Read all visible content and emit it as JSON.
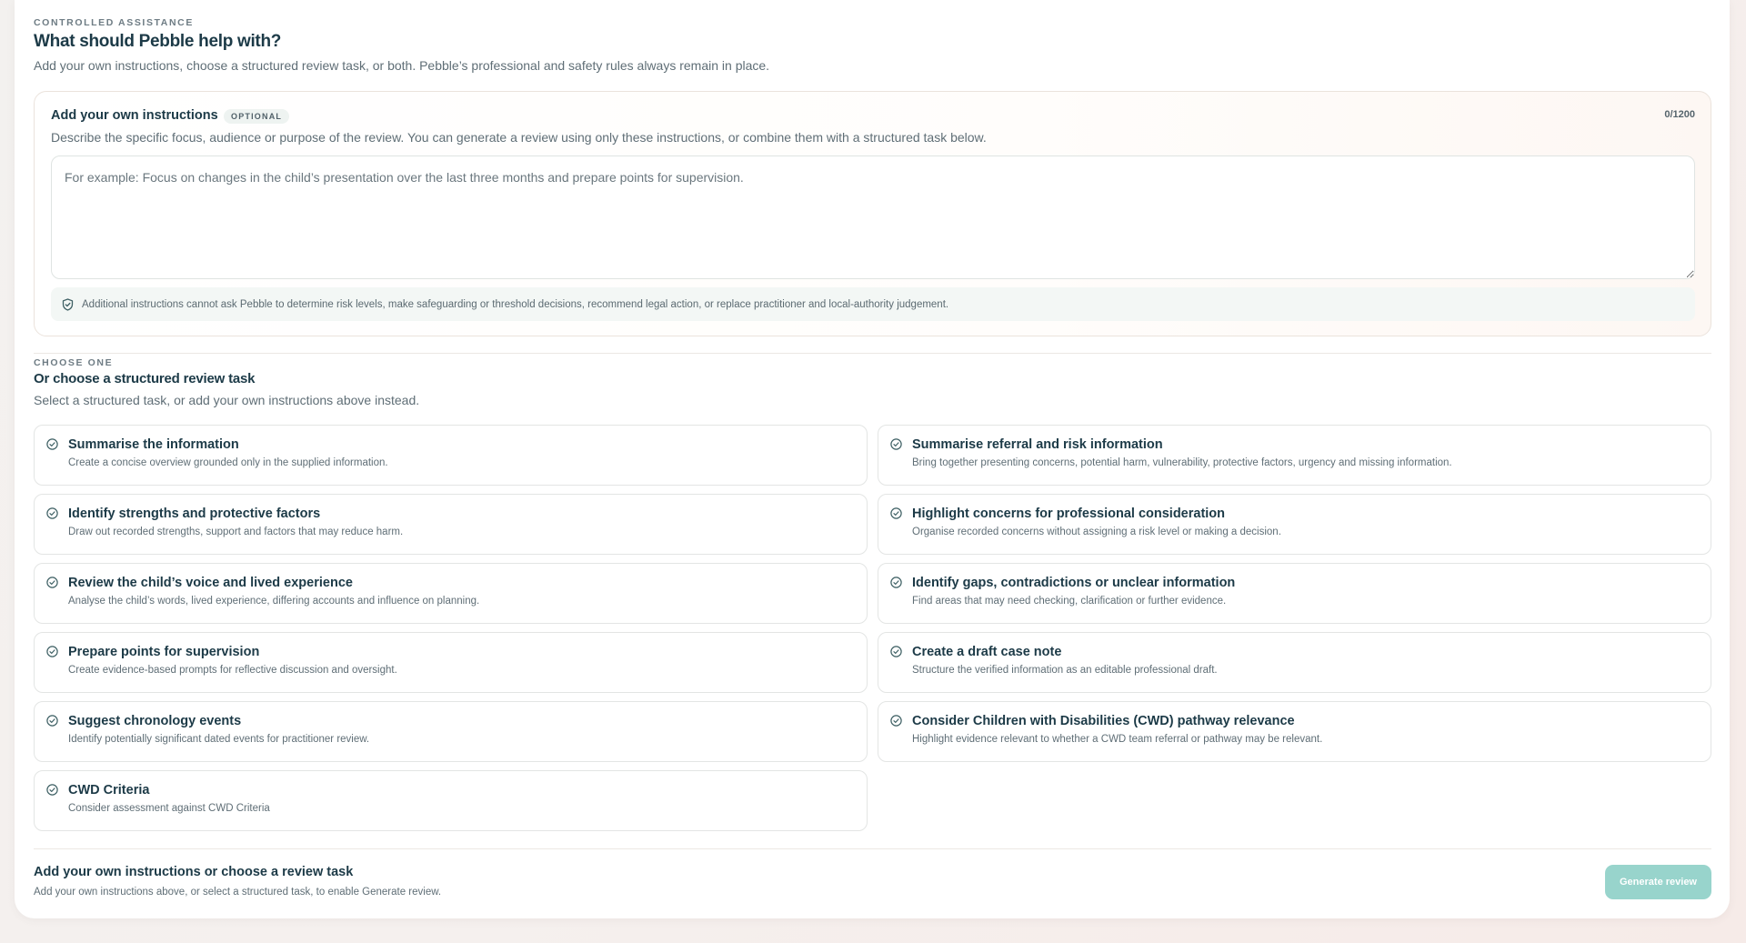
{
  "header": {
    "eyebrow": "CONTROLLED ASSISTANCE",
    "title": "What should Pebble help with?",
    "subtitle": "Add your own instructions, choose a structured review task, or both. Pebble’s professional and safety rules always remain in place."
  },
  "instructions": {
    "title": "Add your own instructions",
    "badge": "OPTIONAL",
    "char_count": "0/1200",
    "description": "Describe the specific focus, audience or purpose of the review. You can generate a review using only these instructions, or combine them with a structured task below.",
    "placeholder": "For example: Focus on changes in the child’s presentation over the last three months and prepare points for supervision.",
    "value": "",
    "notice_icon": "shield-check-icon",
    "notice": "Additional instructions cannot ask Pebble to determine risk levels, make safeguarding or threshold decisions, recommend legal action, or replace practitioner and local-authority judgement."
  },
  "tasks_section": {
    "eyebrow": "CHOOSE ONE",
    "title": "Or choose a structured review task",
    "subtitle": "Select a structured task, or add your own instructions above instead.",
    "item_icon": "check-circle-icon",
    "tasks": [
      {
        "title": "Summarise the information",
        "description": "Create a concise overview grounded only in the supplied information."
      },
      {
        "title": "Summarise referral and risk information",
        "description": "Bring together presenting concerns, potential harm, vulnerability, protective factors, urgency and missing information."
      },
      {
        "title": "Identify strengths and protective factors",
        "description": "Draw out recorded strengths, support and factors that may reduce harm."
      },
      {
        "title": "Highlight concerns for professional consideration",
        "description": "Organise recorded concerns without assigning a risk level or making a decision."
      },
      {
        "title": "Review the child’s voice and lived experience",
        "description": "Analyse the child’s words, lived experience, differing accounts and influence on planning."
      },
      {
        "title": "Identify gaps, contradictions or unclear information",
        "description": "Find areas that may need checking, clarification or further evidence."
      },
      {
        "title": "Prepare points for supervision",
        "description": "Create evidence-based prompts for reflective discussion and oversight."
      },
      {
        "title": "Create a draft case note",
        "description": "Structure the verified information as an editable professional draft."
      },
      {
        "title": "Suggest chronology events",
        "description": "Identify potentially significant dated events for practitioner review."
      },
      {
        "title": "Consider Children with Disabilities (CWD) pathway relevance",
        "description": "Highlight evidence relevant to whether a CWD team referral or pathway may be relevant."
      },
      {
        "title": "CWD Criteria",
        "description": "Consider assessment against CWD Criteria"
      }
    ]
  },
  "footer": {
    "title": "Add your own instructions or choose a review task",
    "subtitle": "Add your own instructions above, or select a structured task, to enable Generate review.",
    "button_label": "Generate review",
    "button_disabled": true
  },
  "colors": {
    "accent": "#98d4cc",
    "heading": "#1c3a47",
    "muted_text": "#5f6e76",
    "check_icon": "#3d5f63"
  }
}
